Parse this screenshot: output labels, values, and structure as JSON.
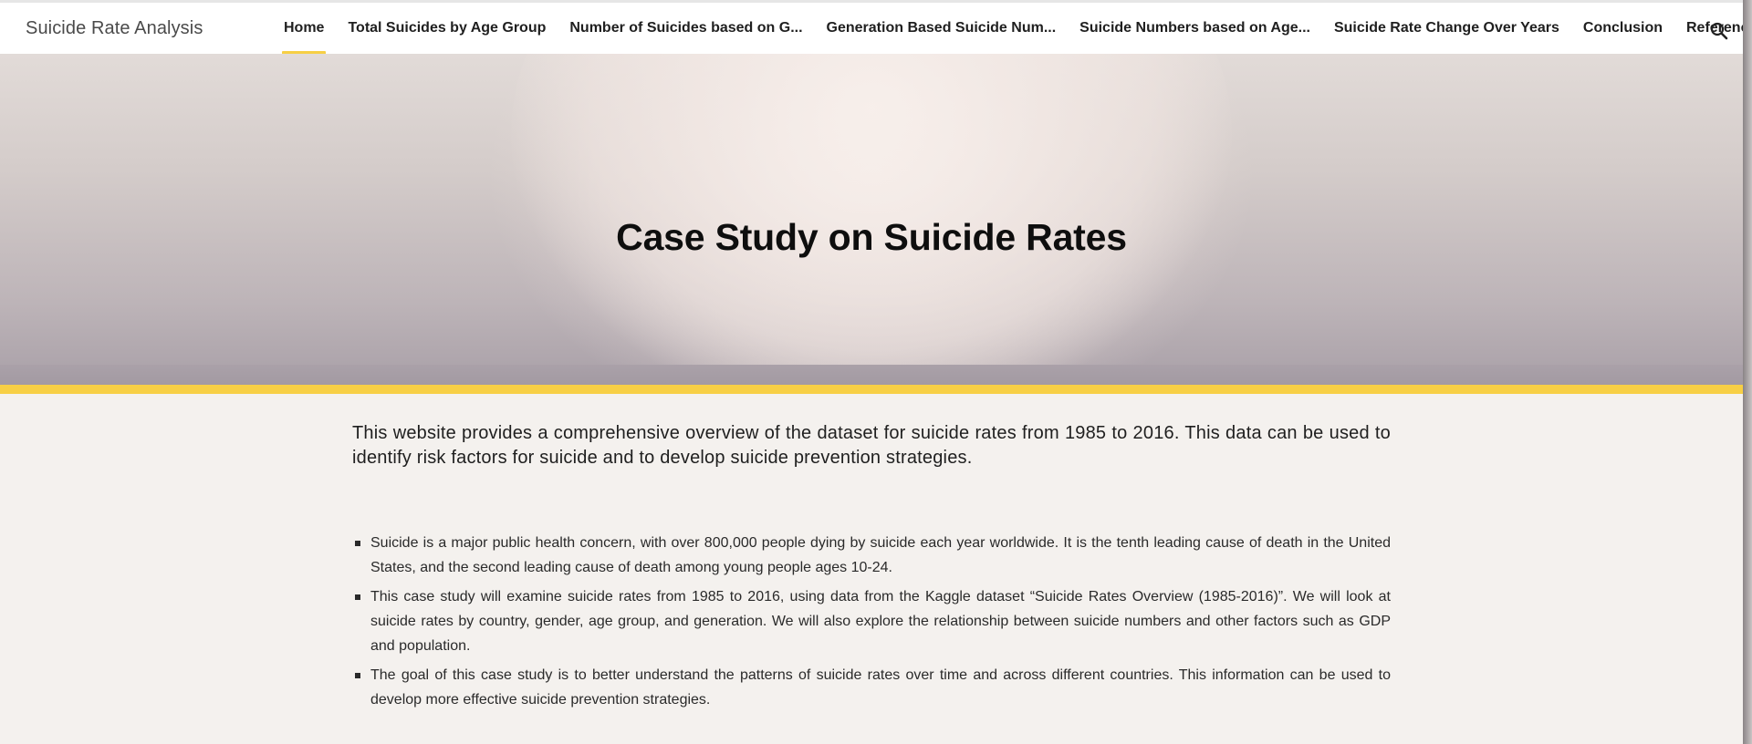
{
  "site": {
    "title": "Suicide Rate Analysis"
  },
  "nav": {
    "items": [
      {
        "label": "Home",
        "active": true
      },
      {
        "label": "Total Suicides by Age Group",
        "active": false
      },
      {
        "label": "Number of Suicides based on G...",
        "active": false
      },
      {
        "label": "Generation Based Suicide Num...",
        "active": false
      },
      {
        "label": "Suicide Numbers based on Age...",
        "active": false
      },
      {
        "label": "Suicide Rate Change Over Years",
        "active": false
      },
      {
        "label": "Conclusion",
        "active": false
      },
      {
        "label": "References",
        "active": false
      }
    ],
    "search_icon": "search-icon"
  },
  "hero": {
    "title": "Case Study on Suicide Rates"
  },
  "content": {
    "intro": "This website provides a comprehensive overview of the dataset for suicide rates from 1985 to 2016. This data can be used to identify risk factors for suicide and to develop suicide prevention strategies.",
    "bullets": [
      "Suicide is a major public health concern, with over 800,000 people dying by suicide each year worldwide. It is the tenth leading cause of death in the United States, and the second leading cause of death among young people ages 10-24.",
      "This case study will examine suicide rates from 1985 to 2016, using data from the Kaggle dataset “Suicide Rates Overview (1985-2016)”. We will look at suicide rates by country, gender, age group, and generation. We will also explore the relationship between suicide numbers and other factors such as GDP and population.",
      "The goal of this case study is to better understand the patterns of suicide rates over time and across different countries. This information can be used to develop more effective suicide prevention strategies."
    ]
  },
  "colors": {
    "accent": "#f7cf45",
    "page_background": "#f4f1ee",
    "header_background": "#ffffff"
  }
}
